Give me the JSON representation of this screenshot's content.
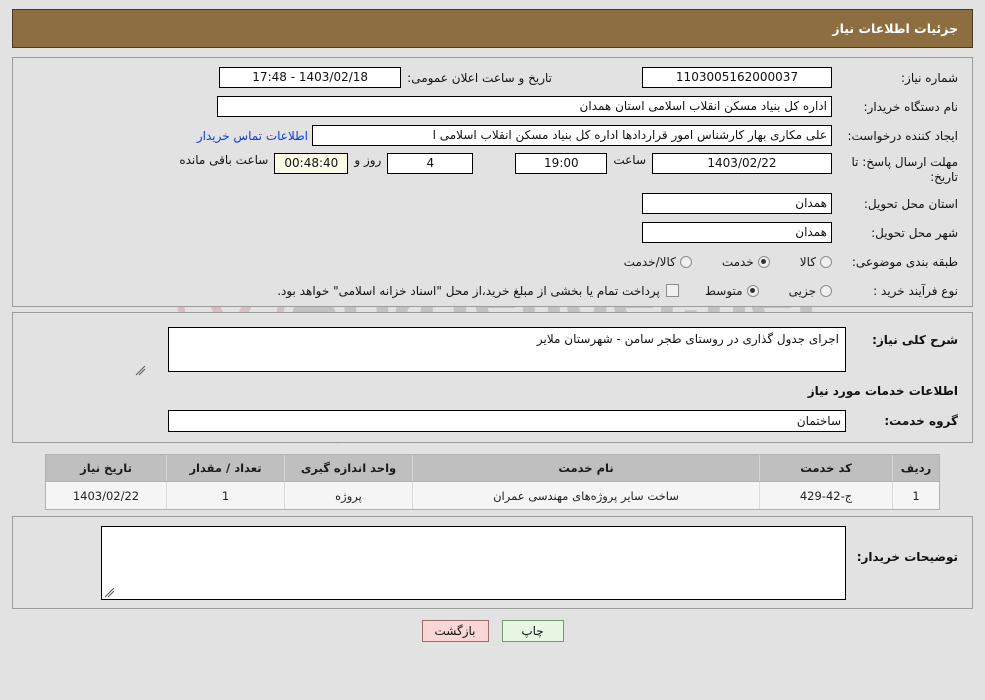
{
  "header": {
    "title": "جزئیات اطلاعات نیاز",
    "bg_color": "#8d6e41",
    "text_color": "#ffffff"
  },
  "top_section": {
    "need_number_label": "شماره نیاز:",
    "need_number_value": "1103005162000037",
    "announce_label": "تاریخ و ساعت اعلان عمومی:",
    "announce_value": "1403/02/18 - 17:48",
    "buyer_org_label": "نام دستگاه خریدار:",
    "buyer_org_value": "اداره کل بنیاد مسکن انقلاب اسلامی استان همدان",
    "creator_label": "ایجاد کننده درخواست:",
    "creator_value": "علی مکاری بهار کارشناس امور قراردادها اداره کل بنیاد مسکن انقلاب اسلامی ا",
    "contact_link": "اطلاعات تماس خریدار",
    "deadline_label_line1": "مهلت ارسال پاسخ: تا",
    "deadline_label_line2": "تاریخ:",
    "deadline_date": "1403/02/22",
    "hour_word": "ساعت",
    "deadline_time": "19:00",
    "days_remaining": "4",
    "days_word": "روز و",
    "countdown": "00:48:40",
    "countdown_suffix": "ساعت باقی مانده",
    "province_label": "استان محل تحویل:",
    "province_value": "همدان",
    "city_label": "شهر محل تحویل:",
    "city_value": "همدان",
    "category_label": "طبقه بندی موضوعی:",
    "category_options": [
      {
        "label": "کالا",
        "selected": false
      },
      {
        "label": "خدمت",
        "selected": true
      },
      {
        "label": "کالا/خدمت",
        "selected": false
      }
    ],
    "process_label": "نوع فرآیند خرید :",
    "process_options": [
      {
        "label": "جزیی",
        "selected": false
      },
      {
        "label": "متوسط",
        "selected": true
      }
    ],
    "payment_checkbox_label": "پرداخت تمام یا بخشی از مبلغ خرید،از محل \"اسناد خزانه اسلامی\" خواهد بود.",
    "payment_checked": false
  },
  "middle_section": {
    "general_desc_label": "شرح کلی نیاز:",
    "general_desc_value": "اجرای جدول گذاری در روستای طجر سامن - شهرستان ملایر",
    "services_info_title": "اطلاعات خدمات مورد نیاز",
    "service_group_label": "گروه خدمت:",
    "service_group_value": "ساختمان"
  },
  "table": {
    "headers": [
      "ردیف",
      "کد خدمت",
      "نام خدمت",
      "واحد اندازه گیری",
      "تعداد / مقدار",
      "تاریخ نیاز"
    ],
    "rows": [
      {
        "radif": "1",
        "code": "ج-42-429",
        "name": "ساخت سایر پروژه‌های مهندسی عمران",
        "unit": "پروژه",
        "qty": "1",
        "date": "1403/02/22"
      }
    ]
  },
  "notes": {
    "label": "توضیحات خریدار:",
    "value": ""
  },
  "footer": {
    "print_label": "چاپ",
    "back_label": "بازگشت",
    "print_color": "#e8f6e4",
    "back_color": "#f9d7d7"
  },
  "watermark": {
    "text": "AriaTender.net"
  }
}
